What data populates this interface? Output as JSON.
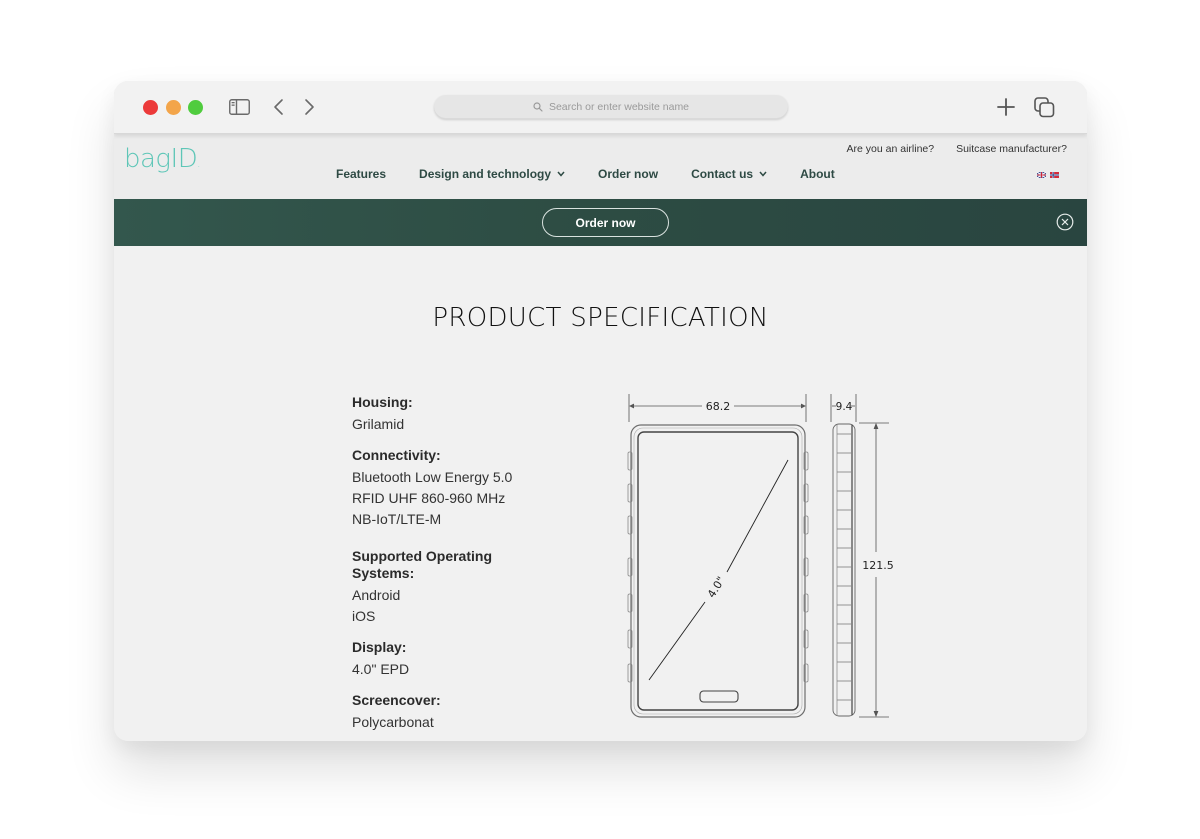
{
  "browser": {
    "url_placeholder": "Search or enter website name",
    "icons": [
      "close-window",
      "minimize-window",
      "maximize-window",
      "sidebar-toggle",
      "back-arrow",
      "forward-arrow",
      "search",
      "new-tab-plus",
      "tab-overview"
    ]
  },
  "site": {
    "logo": "bagID",
    "logo_mark": ".",
    "brand_color": "#5ec6b7",
    "top_links": [
      "Are you an airline?",
      "Suitcase manufacturer?"
    ],
    "nav": [
      {
        "label": "Features",
        "has_dropdown": false
      },
      {
        "label": "Design and technology",
        "has_dropdown": true
      },
      {
        "label": "Order now",
        "has_dropdown": false
      },
      {
        "label": "Contact us",
        "has_dropdown": true
      },
      {
        "label": "About",
        "has_dropdown": false
      }
    ],
    "languages": [
      "English",
      "Norwegian"
    ]
  },
  "banner": {
    "button_label": "Order now",
    "background_color": "#2f4f47",
    "close_icon": "close-circle"
  },
  "main": {
    "title": "PRODUCT SPECIFICATION",
    "specs": [
      {
        "label": "Housing:",
        "values": [
          "Grilamid"
        ]
      },
      {
        "label": "Connectivity:",
        "values": [
          "Bluetooth Low Energy 5.0",
          "RFID UHF 860-960 MHz",
          "NB-IoT/LTE-M"
        ]
      },
      {
        "label": "Supported Operating Systems:",
        "values": [
          "Android",
          "iOS"
        ]
      },
      {
        "label": "Display:",
        "values": [
          "4.0\" EPD"
        ]
      },
      {
        "label": "Screencover:",
        "values": [
          "Polycarbonat"
        ]
      }
    ],
    "drawing": {
      "width_label": "68.2",
      "depth_label": "9.4",
      "height_label": "121.5",
      "diagonal_label": "4.0\""
    }
  }
}
